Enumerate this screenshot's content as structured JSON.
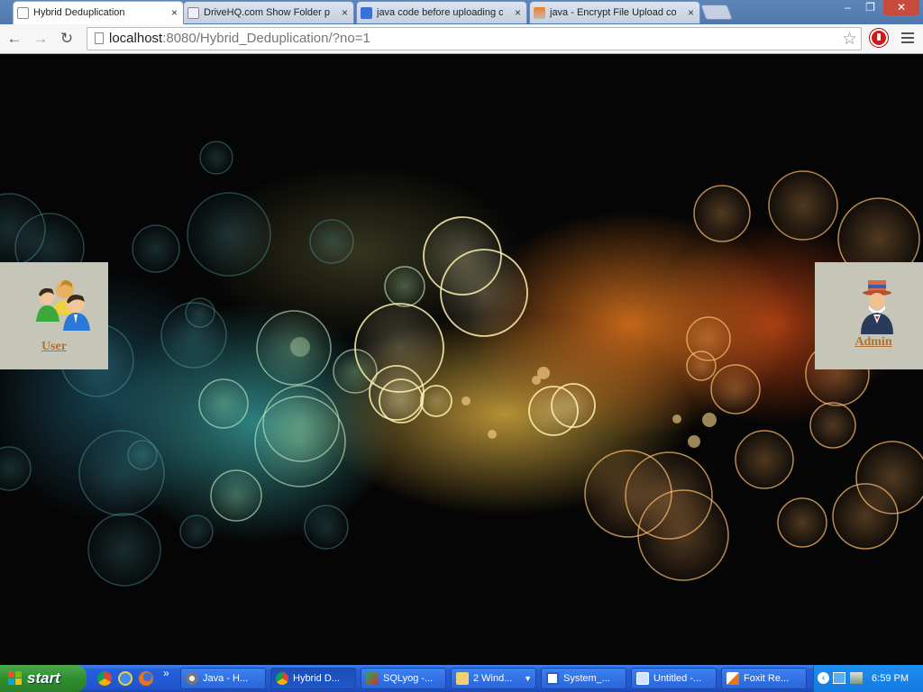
{
  "browser": {
    "tabs": [
      {
        "label": "Hybrid Deduplication",
        "active": true,
        "favicon": "page-icon"
      },
      {
        "label": "DriveHQ.com Show Folder pa",
        "active": false,
        "favicon": "page-icon"
      },
      {
        "label": "java code before uploading c",
        "active": false,
        "favicon": "google-icon"
      },
      {
        "label": "java - Encrypt File Upload co",
        "active": false,
        "favicon": "stackoverflow-icon"
      }
    ],
    "close_glyph": "×",
    "window_controls": {
      "minimize": "–",
      "maximize": "❐",
      "close": "✕"
    },
    "nav": {
      "back": "←",
      "forward": "→",
      "reload": "↻"
    },
    "url": {
      "host": "localhost",
      "rest": ":8080/Hybrid_Deduplication/?no=1"
    },
    "bookmark_star": "☆"
  },
  "page": {
    "user_panel": {
      "label": "User",
      "icon": "users-group-icon"
    },
    "admin_panel": {
      "label": "Admin",
      "icon": "admin-uncle-sam-icon"
    }
  },
  "taskbar": {
    "start_label": "start",
    "quick_launch": [
      "chrome-icon",
      "ie-icon",
      "firefox-icon"
    ],
    "overflow": "»",
    "items": [
      {
        "label": "Java - H...",
        "icon": "java-gear-icon",
        "active": false
      },
      {
        "label": "Hybrid D...",
        "icon": "chrome-icon",
        "active": true
      },
      {
        "label": "SQLyog -...",
        "icon": "sqlyog-icon",
        "active": false
      },
      {
        "label": "2 Wind...",
        "icon": "folder-icon",
        "active": false
      },
      {
        "label": "System_...",
        "icon": "word-doc-icon",
        "active": false
      },
      {
        "label": "Untitled -...",
        "icon": "notepad-icon",
        "active": false
      },
      {
        "label": "Foxit Re...",
        "icon": "foxit-icon",
        "active": false
      }
    ],
    "clock": "6:59 PM"
  },
  "colors": {
    "link": "#b07030",
    "panel_bg": "#c6c6b8",
    "taskbar": "#245edb",
    "start_green": "#2f8f2f"
  }
}
